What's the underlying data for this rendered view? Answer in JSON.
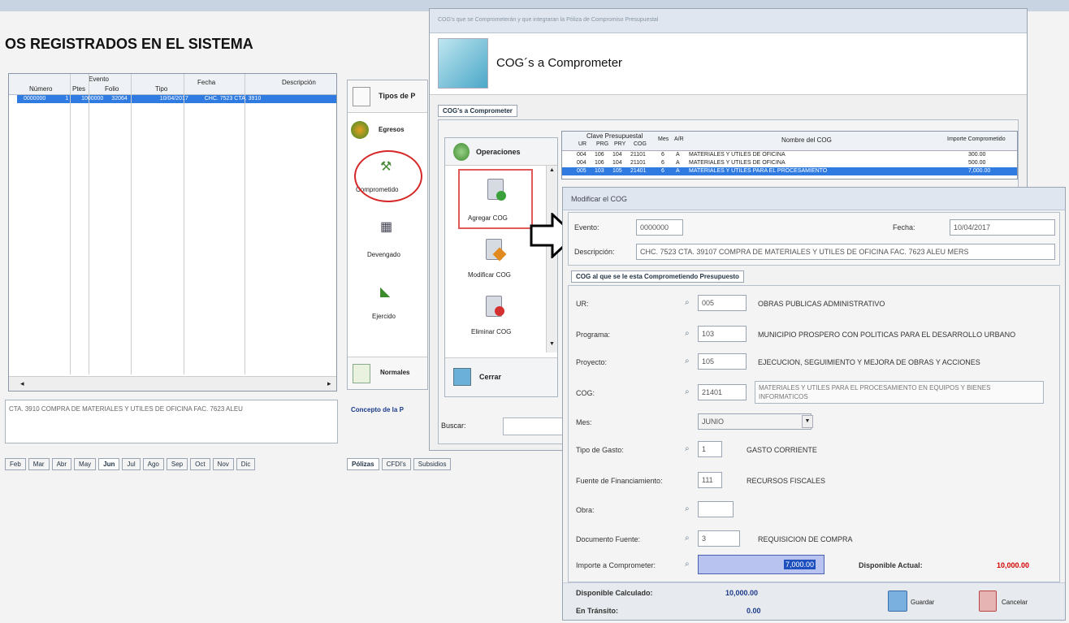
{
  "main": {
    "title": "OS REGISTRADOS EN EL SISTEMA",
    "table_headers": {
      "evento": "Evento",
      "numero": "Número",
      "ptes": "Ptes",
      "folio": "Folio",
      "tipo": "Tipo",
      "fecha": "Fecha",
      "descripcion": "Descripción"
    },
    "selected_row": [
      "0000000",
      "1",
      "1000000",
      "32064",
      "10/04/2017",
      "CHC. 7523 CTA. 3910"
    ],
    "bottom_text": "CTA. 3910 COMPRA DE MATERIALES Y UTILES DE OFICINA FAC. 7623 ALEU",
    "months": [
      "Feb",
      "Mar",
      "Abr",
      "May",
      "Jun",
      "Jul",
      "Ago",
      "Sep",
      "Oct",
      "Nov",
      "Dic"
    ],
    "active_month": "Jun"
  },
  "middle": {
    "types_label": "Tipos de P",
    "egresos": "Egresos",
    "comprometido": "Comprometido",
    "devengado": "Devengado",
    "ejercido": "Ejercido",
    "normales": "Normales",
    "concepto": "Concepto de la P",
    "tabs": [
      "Pólizas",
      "CFDI's",
      "Subsidios"
    ]
  },
  "cog": {
    "titlebar": "COG's que se Comprometerán y que integraran la Póliza de Compromiso Presupuestal",
    "header": "COG´s a Comprometer",
    "tab": "COG's a Comprometer",
    "operaciones": "Operaciones",
    "agregar": "Agregar COG",
    "modificar": "Modificar COG",
    "eliminar": "Eliminar COG",
    "cerrar": "Cerrar",
    "buscar": "Buscar:",
    "grid_headers": {
      "clave": "Clave Presupuestal",
      "ur": "UR",
      "prg": "PRG",
      "prv": "PRY",
      "cog": "COG",
      "mes": "Mes",
      "ar": "A/R",
      "nombre": "Nombre del COG",
      "importe": "Importe Comprometido"
    },
    "rows": [
      {
        "ur": "004",
        "prg": "106",
        "prv": "104",
        "cog": "21101",
        "mes": "6",
        "ar": "A",
        "nombre": "MATERIALES Y UTILES DE OFICINA",
        "importe": "300.00"
      },
      {
        "ur": "004",
        "prg": "106",
        "prv": "104",
        "cog": "21101",
        "mes": "6",
        "ar": "A",
        "nombre": "MATERIALES Y UTILES DE OFICINA",
        "importe": "500.00"
      },
      {
        "ur": "005",
        "prg": "103",
        "prv": "105",
        "cog": "21401",
        "mes": "6",
        "ar": "A",
        "nombre": "MATERIALES Y UTILES PARA EL PROCESAMIENTO",
        "importe": "7,000.00"
      }
    ]
  },
  "modal": {
    "title": "Modificar el COG",
    "evento_label": "Evento:",
    "evento_value": "0000000",
    "fecha_label": "Fecha:",
    "fecha_value": "10/04/2017",
    "descripcion_label": "Descripción:",
    "descripcion_value": "CHC. 7523 CTA. 39107 COMPRA DE MATERIALES Y UTILES DE OFICINA FAC. 7623 ALEU MERS",
    "tab": "COG al que se le esta Comprometiendo Presupuesto",
    "ur_label": "UR:",
    "ur_value": "005",
    "ur_desc": "OBRAS PUBLICAS ADMINISTRATIVO",
    "programa_label": "Programa:",
    "programa_value": "103",
    "programa_desc": "MUNICIPIO PROSPERO CON POLITICAS PARA EL DESARROLLO URBANO",
    "proyecto_label": "Proyecto:",
    "proyecto_value": "105",
    "proyecto_desc": "EJECUCION, SEGUIMIENTO Y MEJORA DE OBRAS Y ACCIONES",
    "cog_label": "COG:",
    "cog_value": "21401",
    "cog_desc": "MATERIALES Y UTILES PARA EL PROCESAMIENTO EN EQUIPOS Y BIENES INFORMATICOS",
    "mes_label": "Mes:",
    "mes_value": "JUNIO",
    "tipo_gasto_label": "Tipo de Gasto:",
    "tipo_gasto_value": "1",
    "tipo_gasto_desc": "GASTO CORRIENTE",
    "fuente_label": "Fuente de Financiamiento:",
    "fuente_value": "111",
    "fuente_desc": "RECURSOS FISCALES",
    "obra_label": "Obra:",
    "obra_value": "",
    "documento_label": "Documento Fuente:",
    "documento_value": "3",
    "documento_desc": "REQUISICION DE COMPRA",
    "importe_label": "Importe a Comprometer:",
    "importe_value": "7,000.00",
    "disponible_actual_label": "Disponible Actual:",
    "disponible_actual_value": "10,000.00",
    "disponible_calc_label": "Disponible Calculado:",
    "disponible_calc_value": "10,000.00",
    "en_transito_label": "En Tránsito:",
    "en_transito_value": "0.00",
    "guardar": "Guardar",
    "cancelar": "Cancelar"
  }
}
